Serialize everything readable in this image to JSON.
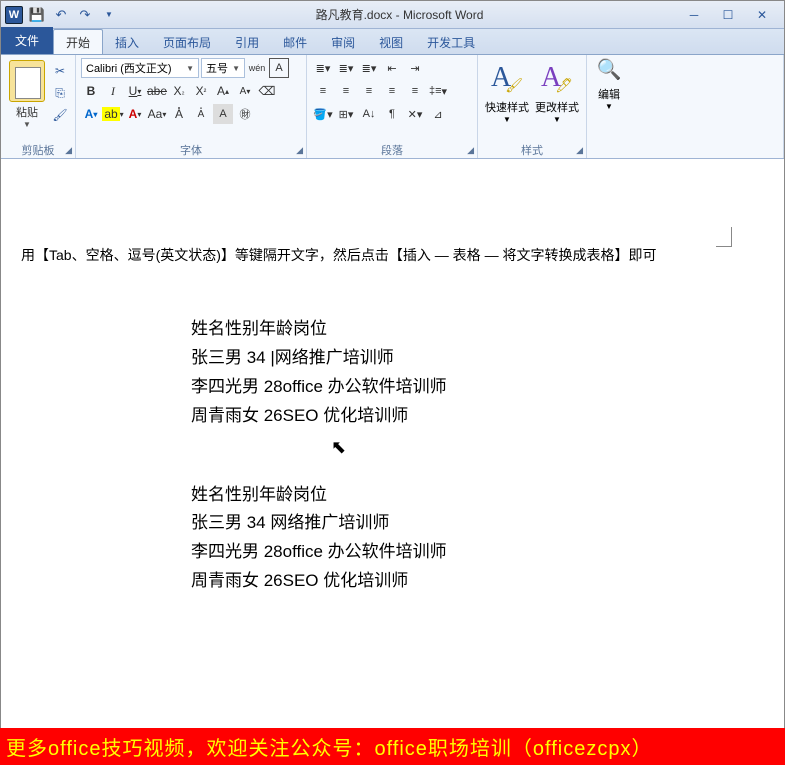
{
  "app": {
    "doc_title": "路凡教育.docx - Microsoft Word",
    "word_icon_letter": "W"
  },
  "tabs": {
    "file": "文件",
    "items": [
      "开始",
      "插入",
      "页面布局",
      "引用",
      "邮件",
      "审阅",
      "视图",
      "开发工具"
    ],
    "active_index": 0
  },
  "ribbon": {
    "clipboard": {
      "label": "剪贴板",
      "paste": "粘贴"
    },
    "font": {
      "label": "字体",
      "name": "Calibri (西文正文)",
      "size": "五号",
      "wen": "wén",
      "bold": "B",
      "italic": "I",
      "underline": "U",
      "strike": "abe",
      "x2": "X",
      "aa": "Aa",
      "ruby": "A",
      "border": "A"
    },
    "para": {
      "label": "段落"
    },
    "styles": {
      "label": "样式",
      "quick": "快速样式",
      "change": "更改样式"
    },
    "edit": {
      "label": "编辑"
    }
  },
  "document": {
    "instruction": "用【Tab、空格、逗号(英文状态)】等键隔开文字，然后点击【插入 — 表格 — 将文字转换成表格】即可",
    "block1": [
      "姓名性别年龄岗位",
      "张三男 34 |网络推广培训师",
      "李四光男 28office 办公软件培训师",
      "周青雨女 26SEO 优化培训师"
    ],
    "block2": [
      "姓名性别年龄岗位",
      "张三男 34 网络推广培训师",
      "李四光男 28office 办公软件培训师",
      "周青雨女 26SEO 优化培训师"
    ]
  },
  "footer": "更多office技巧视频，欢迎关注公众号：office职场培训（officezcpx）"
}
